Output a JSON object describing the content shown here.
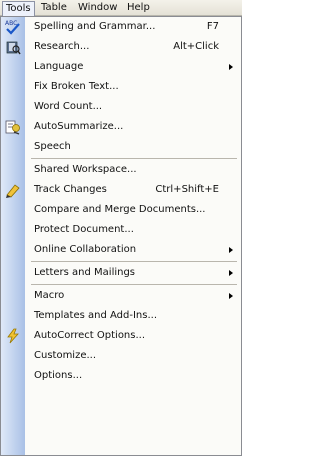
{
  "menubar": {
    "items": [
      {
        "label": "Tools",
        "active": true
      },
      {
        "label": "Table"
      },
      {
        "label": "Window"
      },
      {
        "label": "Help"
      }
    ]
  },
  "menu": [
    {
      "label": "Spelling and Grammar...",
      "shortcut": "F7",
      "icon": "spelling-check-icon"
    },
    {
      "label": "Research...",
      "shortcut": "Alt+Click",
      "icon": "research-book-icon"
    },
    {
      "label": "Language",
      "submenu": true
    },
    {
      "label": "Fix Broken Text..."
    },
    {
      "label": "Word Count..."
    },
    {
      "label": "AutoSummarize...",
      "icon": "autosummarize-icon"
    },
    {
      "label": "Speech"
    },
    {
      "separator": true
    },
    {
      "label": "Shared Workspace..."
    },
    {
      "label": "Track Changes",
      "shortcut": "Ctrl+Shift+E",
      "icon": "track-changes-icon"
    },
    {
      "label": "Compare and Merge Documents..."
    },
    {
      "label": "Protect Document..."
    },
    {
      "label": "Online Collaboration",
      "submenu": true
    },
    {
      "separator": true
    },
    {
      "label": "Letters and Mailings",
      "submenu": true
    },
    {
      "separator": true
    },
    {
      "label": "Macro",
      "submenu": true
    },
    {
      "label": "Templates and Add-Ins..."
    },
    {
      "label": "AutoCorrect Options...",
      "icon": "lightning-icon"
    },
    {
      "label": "Customize..."
    },
    {
      "label": "Options..."
    }
  ]
}
